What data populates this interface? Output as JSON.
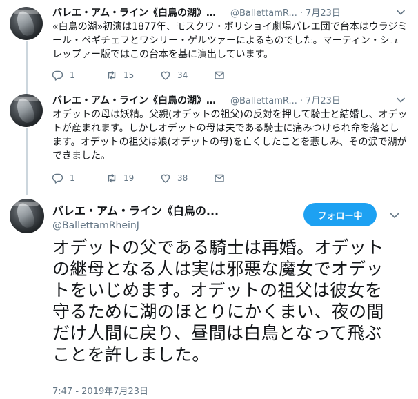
{
  "tweets": [
    {
      "display_name": "バレエ・アム・ライン《白鳥の湖》日本公演...",
      "handle": "@BallettamR...",
      "time": "7月23日",
      "text": "«白鳥の湖»初演は1877年、モスクワ・ボリショイ劇場バレエ団で台本はウラジミール・ペギチェフとワシリー・ゲルツァーによるものでした。マーティン・シュレップァー版ではこの台本を基に演出しています。",
      "replies": "1",
      "retweets": "15",
      "likes": "34"
    },
    {
      "display_name": "バレエ・アム・ライン《白鳥の湖》日本公演...",
      "handle": "@BallettamR...",
      "time": "7月23日",
      "text": "オデットの母は妖精。父親(オデットの祖父)の反対を押して騎士と結婚し、オデットが産まれます。しかしオデットの母は夫である騎士に痛みつけられ命を落とします。オデットの祖父は娘(オデットの母)を亡くしたことを悲しみ、その涙で湖ができました。",
      "replies": "1",
      "retweets": "19",
      "likes": "38"
    }
  ],
  "main_tweet": {
    "display_name": "バレエ・アム・ライン《白鳥の...",
    "handle": "@BallettamRheinJ",
    "follow_label": "フォロー中",
    "text": "オデットの父である騎士は再婚。オデットの継母となる人は実は邪悪な魔女でオデットをいじめます。オデットの祖父は彼女を守るために湖のほとりにかくまい、夜の間だけ人間に戻り、昼間は白鳥となって飛ぶことを許しました。",
    "timestamp": "7:47 - 2019年7月23日"
  },
  "icons": {
    "reply": "reply-icon",
    "retweet": "retweet-icon",
    "like": "heart-icon",
    "message": "direct-message-icon",
    "caret": "chevron-down-icon"
  },
  "colors": {
    "accent": "#1da1f2",
    "secondary_text": "#657786",
    "thread_line": "#ccd6dd"
  }
}
